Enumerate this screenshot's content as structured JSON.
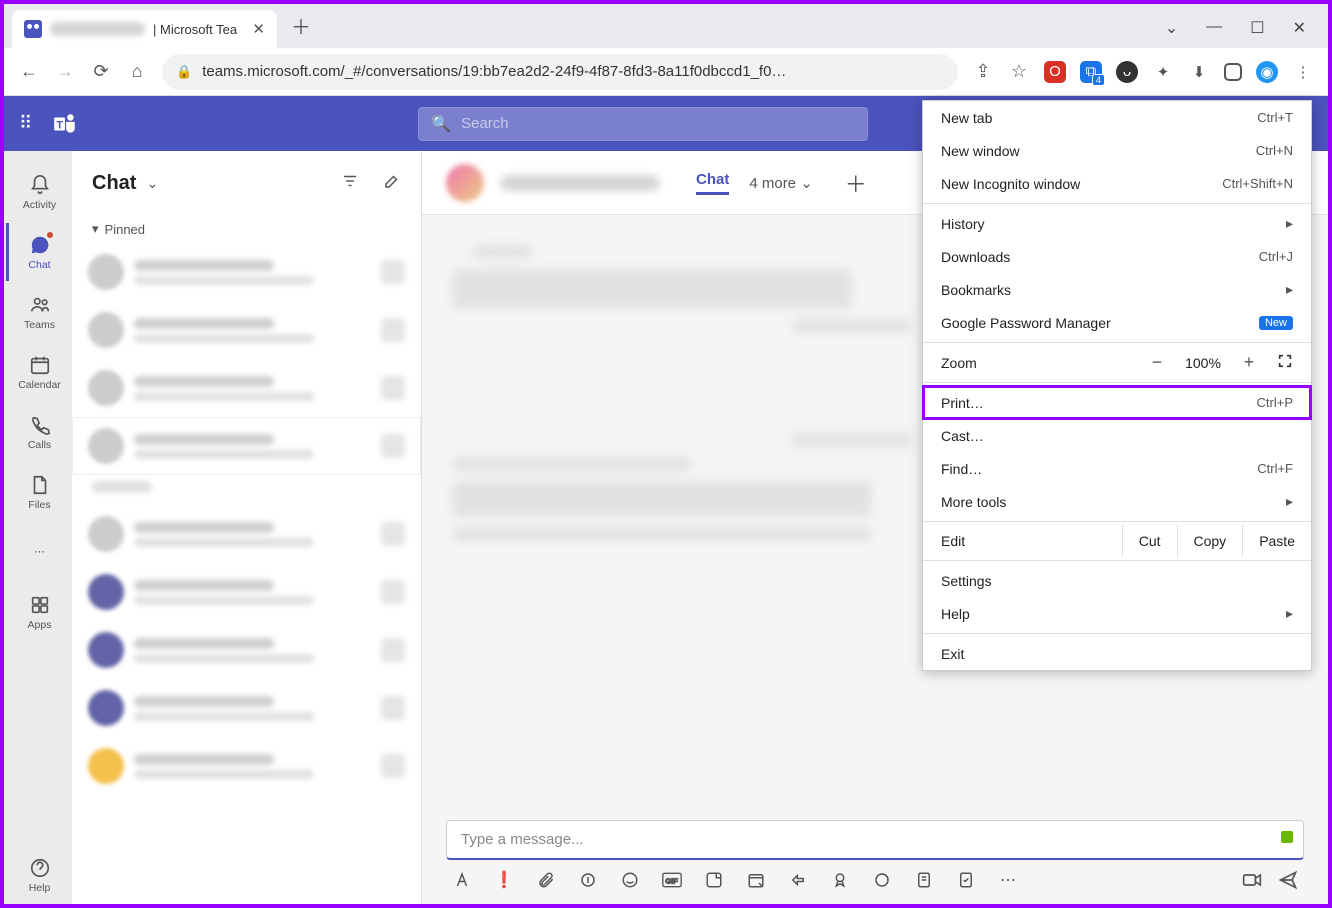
{
  "browser": {
    "tab_title": "| Microsoft Tea",
    "url": "teams.microsoft.com/_#/conversations/19:bb7ea2d2-24f9-4f87-8fd3-8a11f0dbccd1_f0…",
    "ext_badge": "4"
  },
  "teams": {
    "search_placeholder": "Search",
    "rail": {
      "activity": "Activity",
      "chat": "Chat",
      "teams": "Teams",
      "calendar": "Calendar",
      "calls": "Calls",
      "files": "Files",
      "apps": "Apps",
      "help": "Help"
    },
    "chatlist": {
      "title": "Chat",
      "pinned": "Pinned"
    },
    "conv": {
      "tab_chat": "Chat",
      "tab_more": "4 more",
      "compose_placeholder": "Type a message..."
    }
  },
  "menu": {
    "new_tab": "New tab",
    "new_tab_kbd": "Ctrl+T",
    "new_window": "New window",
    "new_window_kbd": "Ctrl+N",
    "new_incognito": "New Incognito window",
    "new_incognito_kbd": "Ctrl+Shift+N",
    "history": "History",
    "downloads": "Downloads",
    "downloads_kbd": "Ctrl+J",
    "bookmarks": "Bookmarks",
    "gpm": "Google Password Manager",
    "gpm_badge": "New",
    "zoom": "Zoom",
    "zoom_val": "100%",
    "print": "Print…",
    "print_kbd": "Ctrl+P",
    "cast": "Cast…",
    "find": "Find…",
    "find_kbd": "Ctrl+F",
    "more_tools": "More tools",
    "edit": "Edit",
    "cut": "Cut",
    "copy": "Copy",
    "paste": "Paste",
    "settings": "Settings",
    "help": "Help",
    "exit": "Exit"
  }
}
